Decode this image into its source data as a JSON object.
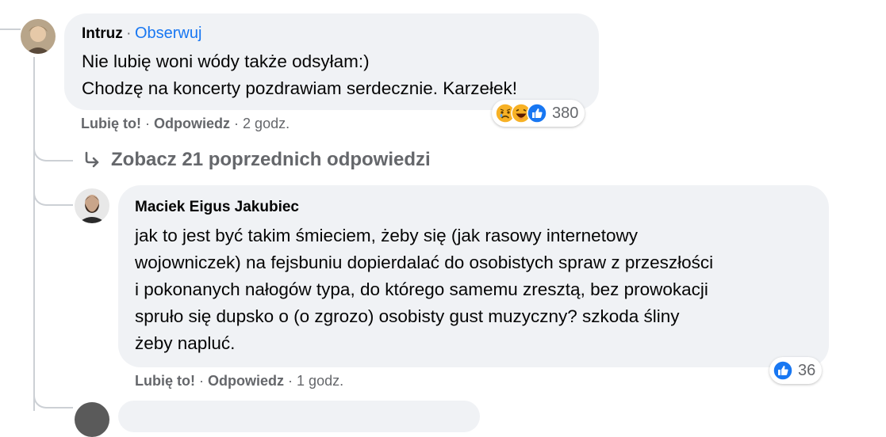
{
  "comment1": {
    "author": "Intruz",
    "separator": "·",
    "follow_label": "Obserwuj",
    "lines": [
      "Nie lubię woni wódy także odsyłam:)",
      "Chodzę na koncerty pozdrawiam serdecznie. Karzełek!"
    ],
    "reaction_icons": [
      "sad-reaction-icon",
      "haha-reaction-icon",
      "like-reaction-icon"
    ],
    "reaction_count": "380",
    "like_label": "Lubię to!",
    "reply_label": "Odpowiedz",
    "time": "2 godz."
  },
  "more_replies": {
    "icon": "reply-arrow-icon",
    "label": "Zobacz 21 poprzednich odpowiedzi"
  },
  "comment2": {
    "author": "Maciek Eigus Jakubiec",
    "lines": [
      "jak to jest być takim śmieciem, żeby się (jak rasowy internetowy",
      "wojowniczek) na fejsbuniu dopierdalać do osobistych spraw z przeszłości",
      "i pokonanych nałogów typa, do którego samemu zresztą, bez prowokacji",
      "spruło się dupsko o (o zgrozo) osobisty gust muzyczny? szkoda śliny",
      "żeby napluć."
    ],
    "reaction_icons": [
      "like-reaction-icon"
    ],
    "reaction_count": "36",
    "like_label": "Lubię to!",
    "reply_label": "Odpowiedz",
    "time": "1 godz."
  },
  "colors": {
    "bubble": "#f0f2f5",
    "link": "#1877f2",
    "secondary_text": "#65676b",
    "like_blue": "#1877f2",
    "reaction_yellow": "#f7b125"
  }
}
